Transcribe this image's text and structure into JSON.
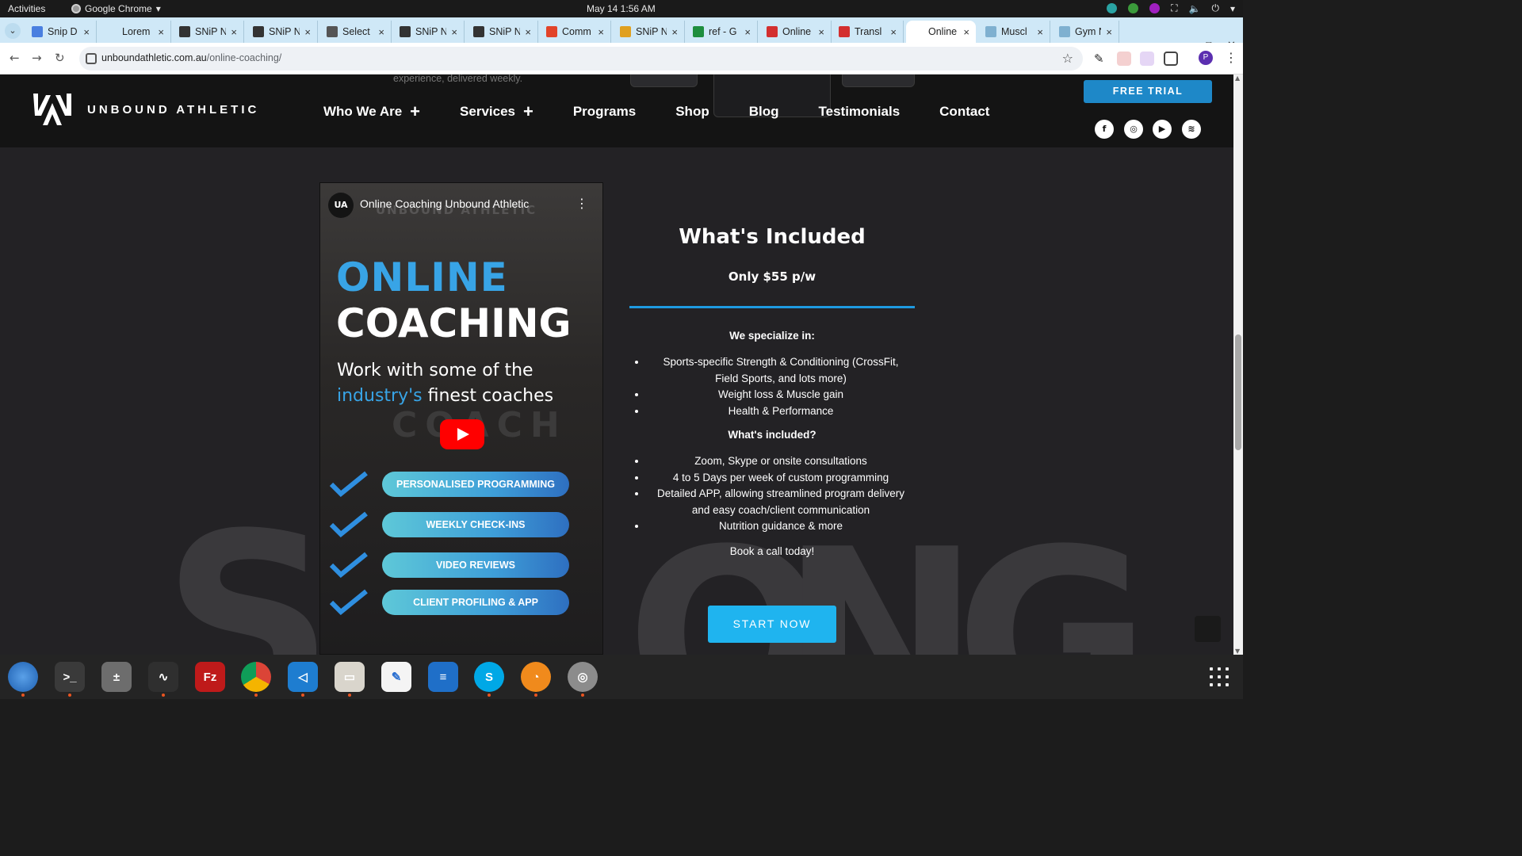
{
  "system_bar": {
    "activities": "Activities",
    "app_name": "Google Chrome",
    "clock": "May 14  1:56 AM"
  },
  "tabs": [
    {
      "title": "Snip D",
      "favicon": "docs-icon",
      "color": "#4a7fe0"
    },
    {
      "title": "Lorem",
      "favicon": "L-icon",
      "color": "#cfe8f7"
    },
    {
      "title": "SNiP N",
      "favicon": "snip-icon",
      "color": "#333333"
    },
    {
      "title": "SNiP N",
      "favicon": "snip-icon",
      "color": "#333333"
    },
    {
      "title": "Select",
      "favicon": "globe-icon",
      "color": "#555555"
    },
    {
      "title": "SNiP N",
      "favicon": "snip-icon",
      "color": "#333333"
    },
    {
      "title": "SNiP N",
      "favicon": "snip-icon",
      "color": "#333333"
    },
    {
      "title": "Comm",
      "favicon": "gitlab-icon",
      "color": "#e24329"
    },
    {
      "title": "SNiP N",
      "favicon": "chrome-icon",
      "color": "#e0a020"
    },
    {
      "title": "ref - G",
      "favicon": "sheets-icon",
      "color": "#1e8e3e"
    },
    {
      "title": "Online",
      "favicon": "pdf-icon",
      "color": "#d32f2f"
    },
    {
      "title": "Transl",
      "favicon": "translate-icon",
      "color": "#d32f2f"
    },
    {
      "title": "Online",
      "favicon": "unbound-icon",
      "color": "#ffffff",
      "active": true
    },
    {
      "title": "Muscl",
      "favicon": "unbound-icon",
      "color": "#7fb0d0"
    },
    {
      "title": "Gym N",
      "favicon": "unbound-icon",
      "color": "#7fb0d0"
    }
  ],
  "address_bar": {
    "domain": "unboundathletic.com.au",
    "path": "/online-coaching/"
  },
  "site": {
    "prev_section_text": "experience, delivered weekly.",
    "brand": "UNBOUND ATHLETIC",
    "nav": [
      {
        "label": "Who We Are",
        "has_plus": true
      },
      {
        "label": "Services",
        "has_plus": true
      },
      {
        "label": "Programs"
      },
      {
        "label": "Shop"
      },
      {
        "label": "Blog"
      },
      {
        "label": "Testimonials"
      },
      {
        "label": "Contact"
      }
    ],
    "free_trial": "FREE TRIAL",
    "social": [
      "facebook-icon",
      "instagram-icon",
      "youtube-icon",
      "spotify-icon"
    ]
  },
  "video": {
    "title": "Online Coaching Unbound Athletic",
    "watermark": "UNBOUND ATHLETIC",
    "headline_1": "ONLINE",
    "headline_2": "COACHING",
    "sub_line_1": "Work with some of the",
    "sub_highlight": "industry's",
    "sub_line_2_rest": " finest coaches",
    "bg_word": "COACH",
    "features": [
      "PERSONALISED PROGRAMMING",
      "WEEKLY CHECK-INS",
      "VIDEO REVIEWS",
      "CLIENT PROFILING & APP"
    ]
  },
  "included": {
    "title": "What's Included",
    "price": "Only $55 p/w",
    "specialize_heading": "We specialize in:",
    "specialize_items": [
      "Sports-specific Strength & Conditioning (CrossFit, Field Sports, and lots more)",
      "Weight loss & Muscle gain",
      "Health & Performance"
    ],
    "included_heading": "What's included?",
    "included_items": [
      "Zoom, Skype or onsite consultations",
      "4 to 5 Days per week of custom programming",
      "Detailed APP, allowing streamlined program delivery and easy coach/client communication",
      "Nutrition guidance & more"
    ],
    "cta_text": "Book a call today!",
    "button": "START NOW"
  },
  "background_letters": [
    "S",
    "O",
    "N",
    "G"
  ],
  "colors": {
    "accent_blue": "#1e9ae0",
    "button_cyan": "#1fb4ef",
    "page_bg": "#232225",
    "header_bg": "#141414"
  },
  "dock": [
    {
      "name": "thunderbird-icon",
      "running": true
    },
    {
      "name": "terminal-icon",
      "running": true
    },
    {
      "name": "calculator-icon",
      "running": false
    },
    {
      "name": "system-monitor-icon",
      "running": true
    },
    {
      "name": "filezilla-icon",
      "running": false
    },
    {
      "name": "chrome-icon",
      "running": true
    },
    {
      "name": "vscode-icon",
      "running": true
    },
    {
      "name": "files-icon",
      "running": true
    },
    {
      "name": "text-editor-icon",
      "running": false
    },
    {
      "name": "writer-icon",
      "running": false
    },
    {
      "name": "skype-icon",
      "running": true
    },
    {
      "name": "burner-icon",
      "running": true
    },
    {
      "name": "disk-utility-icon",
      "running": true
    }
  ]
}
